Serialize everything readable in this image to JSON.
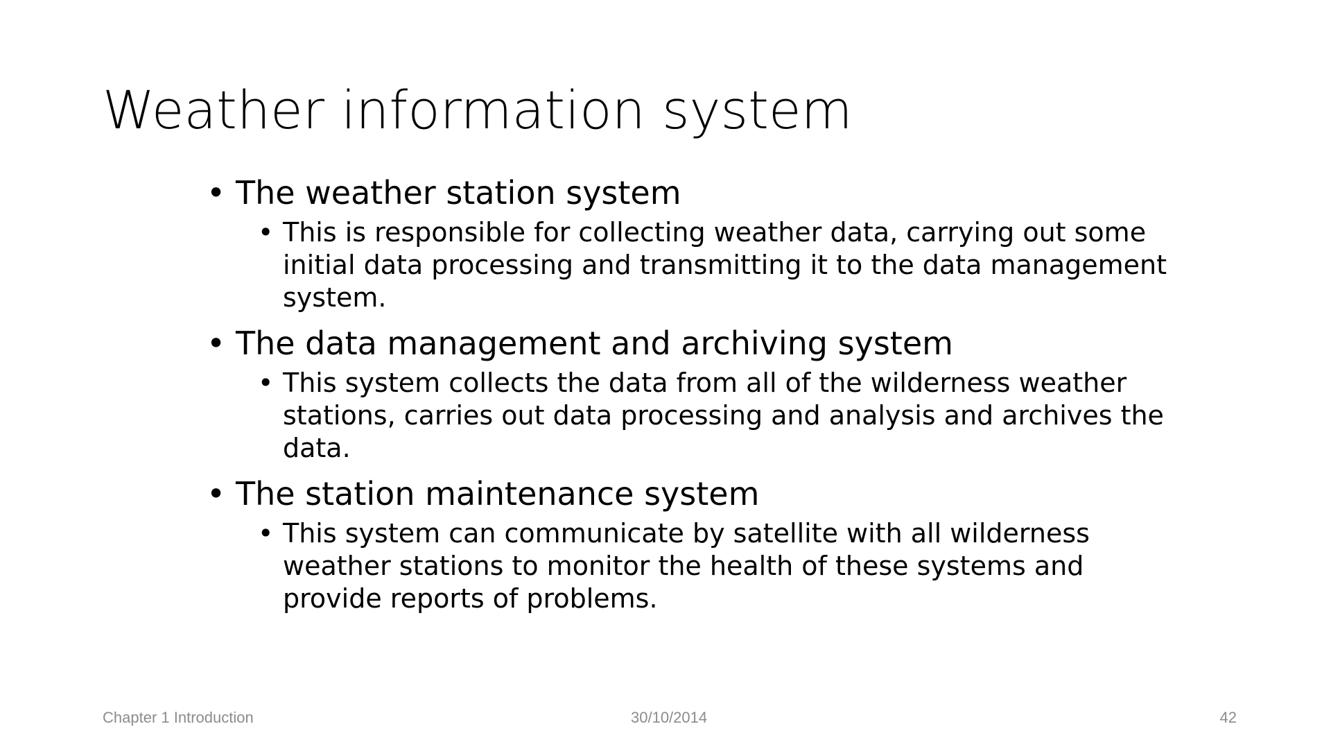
{
  "slide": {
    "title": "Weather information system",
    "bullet_glyph": "•",
    "items": [
      {
        "heading": "The weather station system",
        "detail": "This is responsible for collecting weather data, carrying out some initial data processing and transmitting it to the data management system."
      },
      {
        "heading": "The data management and archiving system",
        "detail": "This system collects the data from all of the wilderness weather stations, carries out data processing and analysis and archives the data."
      },
      {
        "heading": "The station maintenance system",
        "detail": "This system can communicate by satellite with all wilderness weather stations to monitor the health of these systems and provide reports of problems."
      }
    ]
  },
  "footer": {
    "left": "Chapter 1 Introduction",
    "center": "30/10/2014",
    "right": "42"
  },
  "colors": {
    "text": "#000000",
    "footer": "#8c8c8c",
    "background": "#ffffff"
  }
}
